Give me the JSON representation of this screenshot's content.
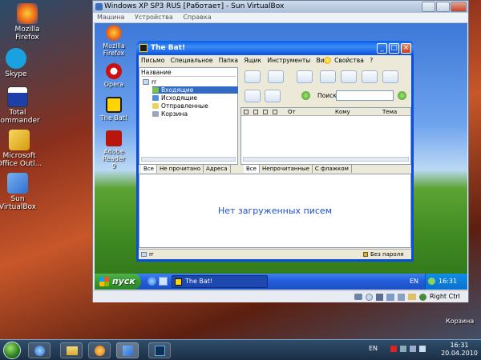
{
  "host": {
    "desktop_icons": [
      {
        "label": "Mozilla\nFirefox",
        "icon": "firefox-icon",
        "color": "#e8631a"
      },
      {
        "label": "Skype",
        "icon": "skype-icon",
        "color": "#1aa2e0"
      },
      {
        "label": "Total\nCommander",
        "icon": "total-commander-icon",
        "color": "#1f3fa8"
      },
      {
        "label": "Microsoft\nOffice Outl...",
        "icon": "outlook-icon",
        "color": "#f0c020"
      },
      {
        "label": "Sun\nVirtualBox",
        "icon": "virtualbox-icon",
        "color": "#2e6fd0"
      }
    ],
    "corner_label": "Корзина",
    "tray_lang": "EN",
    "clock_time": "16:31",
    "clock_date": "20.04.2010"
  },
  "vbox": {
    "title": "Windows XP SP3 RUS [Работает] - Sun VirtualBox",
    "menu": [
      "Машина",
      "Устройства",
      "Справка"
    ],
    "host_key": "Right Ctrl"
  },
  "guest": {
    "desktop_icons": [
      {
        "label": "Mozilla Firefox",
        "icon": "firefox-icon",
        "color": "#e8631a"
      },
      {
        "label": "Opera",
        "icon": "opera-icon",
        "color": "#cc1010"
      },
      {
        "label": "The Bat!",
        "icon": "the-bat-icon",
        "color": "#1b1b1b"
      },
      {
        "label": "Adobe Reader\n9",
        "icon": "adobe-reader-icon",
        "color": "#b8150d"
      }
    ],
    "start_label": "пуск",
    "task_label": "The Bat!",
    "tray_lang": "EN",
    "clock": "16:31"
  },
  "bat": {
    "title": "The Bat!",
    "menu": [
      "Письмо",
      "Специальное",
      "Папка",
      "Ящик",
      "Инструменты",
      "Вид",
      "Свойства",
      "?"
    ],
    "tree_header": "Название",
    "tree_root": "rr",
    "folders": [
      "Входящие",
      "Исходящие",
      "Отправленные",
      "Корзина"
    ],
    "search_label": "Поиск:",
    "columns": [
      "От",
      "Кому",
      "Тема"
    ],
    "left_tabs": [
      "Все",
      "Не прочитано",
      "Адреса"
    ],
    "right_tabs": [
      "Все",
      "Непрочитанные",
      "С флажком"
    ],
    "empty_message": "Нет загруженных писем",
    "status_account": "rr",
    "status_password": "Без пароля",
    "accent_color": "#1a4fd0"
  }
}
